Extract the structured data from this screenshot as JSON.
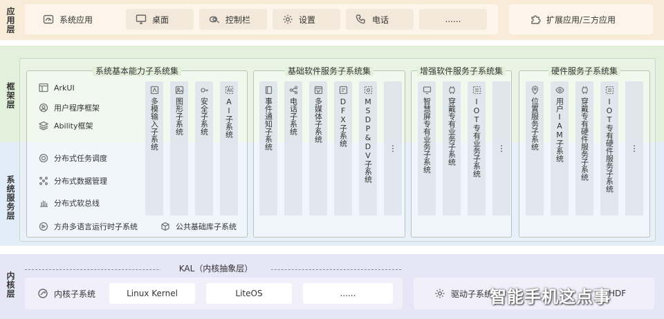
{
  "layers": {
    "app": "应用层",
    "framework": "框架层",
    "system_service": "系统服务层",
    "kernel": "内核层"
  },
  "app_layer": {
    "items": [
      {
        "label": "系统应用",
        "icon": "dashboard-icon"
      },
      {
        "label": "桌面",
        "icon": "monitor-icon"
      },
      {
        "label": "控制栏",
        "icon": "toggle-icon"
      },
      {
        "label": "设置",
        "icon": "gear-icon"
      },
      {
        "label": "电话",
        "icon": "phone-icon"
      },
      {
        "label": "......",
        "icon": ""
      }
    ],
    "extension": {
      "label": "扩展应用/三方应用",
      "icon": "puzzle-icon"
    }
  },
  "basic_capability": {
    "title": "系统基本能力子系统集",
    "features": [
      {
        "label": "ArkUI",
        "icon": "layout-icon"
      },
      {
        "label": "用户程序框架",
        "icon": "gear-user-icon"
      },
      {
        "label": "Ability框架",
        "icon": "layers-icon"
      },
      {
        "label": "分布式任务调度",
        "icon": "schedule-icon"
      },
      {
        "label": "分布式数据管理",
        "icon": "data-dots-icon"
      },
      {
        "label": "分布式软总线",
        "icon": "hand-icon"
      }
    ],
    "bottom": [
      {
        "label": "方舟多语言运行时子系统",
        "icon": "runtime-icon"
      },
      {
        "label": "公共基础库子系统",
        "icon": "cube-icon"
      }
    ],
    "columns": [
      {
        "label": "多模输入子系统",
        "icon": "input-icon"
      },
      {
        "label": "图形子系统",
        "icon": "image-icon"
      },
      {
        "label": "安全子系统",
        "icon": "key-icon"
      },
      {
        "label": "AI子系统",
        "icon": "ai-icon"
      }
    ]
  },
  "base_software": {
    "title": "基础软件服务子系统集",
    "columns": [
      {
        "label": "事件通知子系统",
        "icon": "book-icon"
      },
      {
        "label": "电话子系统",
        "icon": "share-icon"
      },
      {
        "label": "多媒体子系统",
        "icon": "media-icon"
      },
      {
        "label": "DFX子系统",
        "icon": "dfx-icon"
      },
      {
        "label": "MSDP&DV子系统",
        "icon": "msdp-icon"
      },
      {
        "label": "⋮",
        "icon": ""
      }
    ]
  },
  "enhanced_software": {
    "title": "增强软件服务子系统集",
    "columns": [
      {
        "label": "智慧屏专有业务子系统",
        "icon": "screen-icon"
      },
      {
        "label": "穿戴专有业务子系统",
        "icon": "watch-icon"
      },
      {
        "label": "IOT专有业务子系统",
        "icon": "iot-icon"
      },
      {
        "label": "⋮",
        "icon": ""
      }
    ]
  },
  "hardware": {
    "title": "硬件服务子系统集",
    "columns": [
      {
        "label": "位置服务子系统",
        "icon": "location-icon"
      },
      {
        "label": "用户IAM子系统",
        "icon": "eye-icon"
      },
      {
        "label": "穿戴专有硬件服务子系统",
        "icon": "watch-icon"
      },
      {
        "label": "IOT专有硬件服务子系统",
        "icon": "iot-icon"
      },
      {
        "label": "⋮",
        "icon": ""
      }
    ]
  },
  "kernel_layer": {
    "kal": "KAL（内核抽象层）",
    "subsystem": "内核子系统",
    "items": [
      "Linux Kernel",
      "LiteOS",
      "......"
    ],
    "driver": "驱动子系统",
    "driver_tail": "HDF"
  },
  "watermark": "智能手机这点事"
}
